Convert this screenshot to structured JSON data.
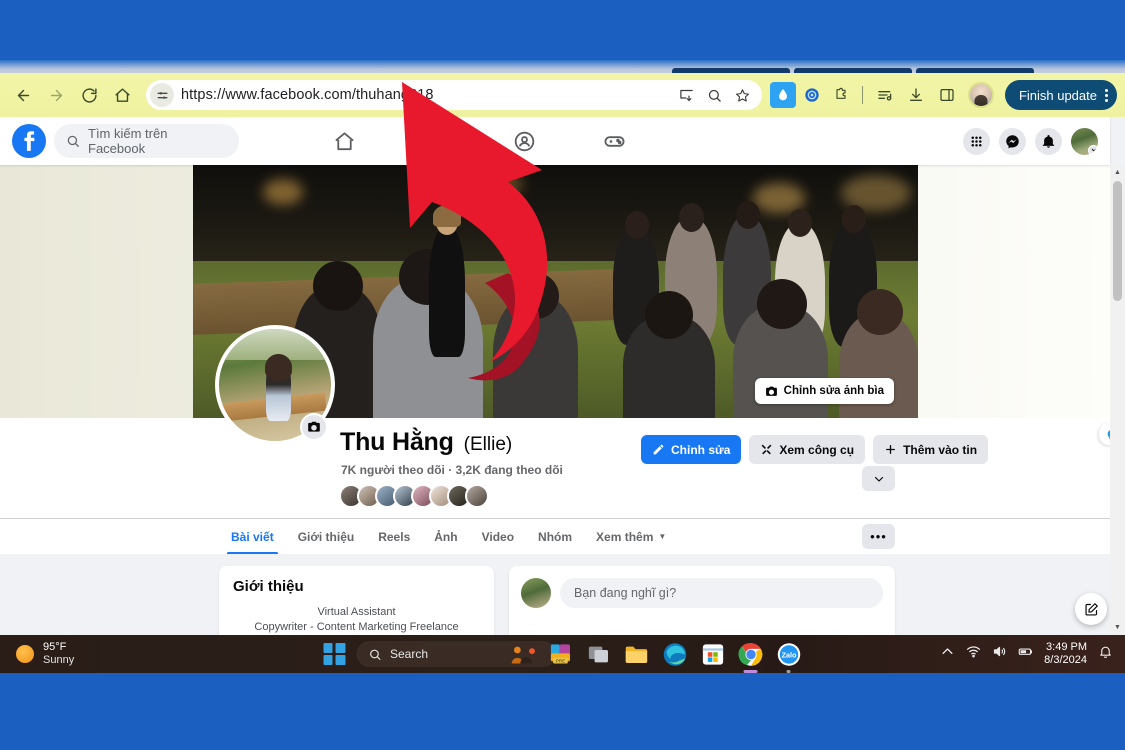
{
  "browser": {
    "url": "https://www.facebook.com/thuhang318",
    "back_label": "Back",
    "forward_label": "Forward",
    "reload_label": "Reload",
    "home_label": "Home",
    "site_info_label": "View site information",
    "finish_update_label": "Finish update",
    "icons": {
      "install": "install-icon",
      "zoom": "zoom-icon",
      "bookmark": "star-icon",
      "ext_water": "water-drop-extension-icon",
      "ext_circle": "shield-extension-icon",
      "ext_puzzle": "extensions-puzzle-icon",
      "reading_list": "reading-list-icon",
      "downloads": "download-icon",
      "side_panel": "side-panel-icon",
      "profile": "chrome-profile-avatar",
      "menu": "three-dot-menu-icon"
    }
  },
  "facebook": {
    "search_placeholder": "Tìm kiếm trên Facebook",
    "nav": [
      {
        "name": "home",
        "label": "Trang chủ"
      },
      {
        "name": "marketplace",
        "label": "Marketplace"
      },
      {
        "name": "groups",
        "label": "Nhóm"
      },
      {
        "name": "gaming",
        "label": "Chơi game"
      }
    ],
    "right_actions": [
      {
        "name": "menu-grid",
        "label": "Menu"
      },
      {
        "name": "messenger",
        "label": "Messenger"
      },
      {
        "name": "notifications",
        "label": "Thông báo"
      },
      {
        "name": "account",
        "label": "Tài khoản"
      }
    ],
    "cover": {
      "edit_label": "Chỉnh sửa ảnh bìa"
    },
    "profile": {
      "name": "Thu Hằng",
      "nickname": "(Ellie)",
      "meta": "7K người theo dõi · 3,2K đang theo dõi",
      "friend_count": 8,
      "buttons": [
        {
          "name": "edit-profile",
          "label": "Chỉnh sửa",
          "style": "primary",
          "icon": "pencil-icon"
        },
        {
          "name": "view-tools",
          "label": "Xem công cụ",
          "style": "secondary",
          "icon": "tools-icon"
        },
        {
          "name": "add-to-story",
          "label": "Thêm vào tin",
          "style": "secondary",
          "icon": "plus-icon"
        }
      ],
      "more_label": "⌄"
    },
    "tabs": [
      {
        "name": "tab-posts",
        "label": "Bài viết",
        "active": true
      },
      {
        "name": "tab-about",
        "label": "Giới thiệu",
        "active": false
      },
      {
        "name": "tab-reels",
        "label": "Reels",
        "active": false
      },
      {
        "name": "tab-photos",
        "label": "Ảnh",
        "active": false
      },
      {
        "name": "tab-videos",
        "label": "Video",
        "active": false
      },
      {
        "name": "tab-groups",
        "label": "Nhóm",
        "active": false
      },
      {
        "name": "tab-more",
        "label": "Xem thêm",
        "active": false,
        "caret": true
      }
    ],
    "tabs_more_label": "•••",
    "intro_card": {
      "title": "Giới thiệu",
      "line1": "Virtual Assistant",
      "line2": "Copywriter - Content Marketing Freelance"
    },
    "composer": {
      "placeholder": "Bạn đang nghĩ gì?"
    }
  },
  "taskbar": {
    "weather": {
      "temp": "95°F",
      "condition": "Sunny"
    },
    "search_placeholder": "Search",
    "apps": [
      {
        "name": "start-button",
        "label": "Start"
      },
      {
        "name": "people-icon",
        "label": "People"
      },
      {
        "name": "pre-app-icon",
        "label": "PRE"
      },
      {
        "name": "task-view-icon",
        "label": "Task View"
      },
      {
        "name": "file-explorer-icon",
        "label": "File Explorer"
      },
      {
        "name": "edge-icon",
        "label": "Microsoft Edge"
      },
      {
        "name": "microsoft-store-icon",
        "label": "Microsoft Store"
      },
      {
        "name": "chrome-icon",
        "label": "Google Chrome"
      },
      {
        "name": "zalo-icon",
        "label": "Zalo"
      }
    ],
    "tray": {
      "time": "3:49 PM",
      "date": "8/3/2024",
      "icons": [
        "chevron-up-icon",
        "wifi-icon",
        "volume-icon",
        "battery-icon",
        "notification-bell-icon"
      ]
    }
  },
  "annotation": {
    "name": "red-curved-arrow",
    "color": "#e8192c",
    "shadow_color": "#9e1020"
  },
  "colors": {
    "facebook_blue": "#1877f2",
    "toolbar_yellow": "#f2f5a6",
    "desktop_blue": "#1b5fc1",
    "finish_update": "#0e4b75"
  }
}
